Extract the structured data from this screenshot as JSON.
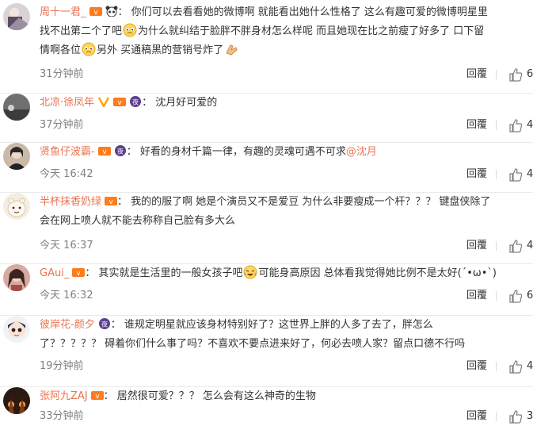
{
  "reply_label": "回覆",
  "comments": [
    {
      "user": "周十一君_",
      "segments": [
        "你们可以去看看她的微博啊 就能看出她什么性格了 这么有趣可爱的微博明星里",
        "找不出第二个了吧",
        "为什么就纠结于脸胖不胖身材怎么样呢 而且她现在比之前瘦了好多了 口下留",
        "情啊各位",
        "另外 买通稿黑的营销号炸了"
      ],
      "time": "31分钟前",
      "likes": "6"
    },
    {
      "user": "北凉·徐凤年",
      "segments": [
        "沈月好可爱的"
      ],
      "time": "37分钟前",
      "likes": "4"
    },
    {
      "user": "贤鱼仔波霸-",
      "segments": [
        "好看的身材千篇一律，有趣的灵魂可遇不可求"
      ],
      "mention": "@沈月",
      "time": "今天 16:42",
      "likes": "4"
    },
    {
      "user": "半杯抹香奶绿",
      "segments": [
        "我的的服了啊 她是个演员又不是爱豆 为什么非要瘦成一个杆？？？ 键盘侠除了",
        "会在网上喷人就不能去称称自己脸有多大么"
      ],
      "time": "今天 16:37",
      "likes": "4"
    },
    {
      "user": "GAui_",
      "segments": [
        "其实就是生活里的一般女孩子吧",
        "可能身高原因  总体看我觉得她比例不是太好(´•ω•`)"
      ],
      "time": "今天 16:32",
      "likes": "6"
    },
    {
      "user": "彼岸花-颜夕",
      "segments": [
        "谁规定明星就应该身材特别好了？这世界上胖的人多了去了，胖怎么",
        "了？？？？？ 碍着你们什么事了吗？不喜欢不要点进来好了，何必去喷人家？留点口德不行吗"
      ],
      "time": "19分钟前",
      "likes": "4"
    },
    {
      "user": "张阿九ZAJ",
      "segments": [
        "居然很可爱？？？ 怎么会有这么神奇的生物"
      ],
      "time": "33分钟前",
      "likes": "3"
    }
  ]
}
